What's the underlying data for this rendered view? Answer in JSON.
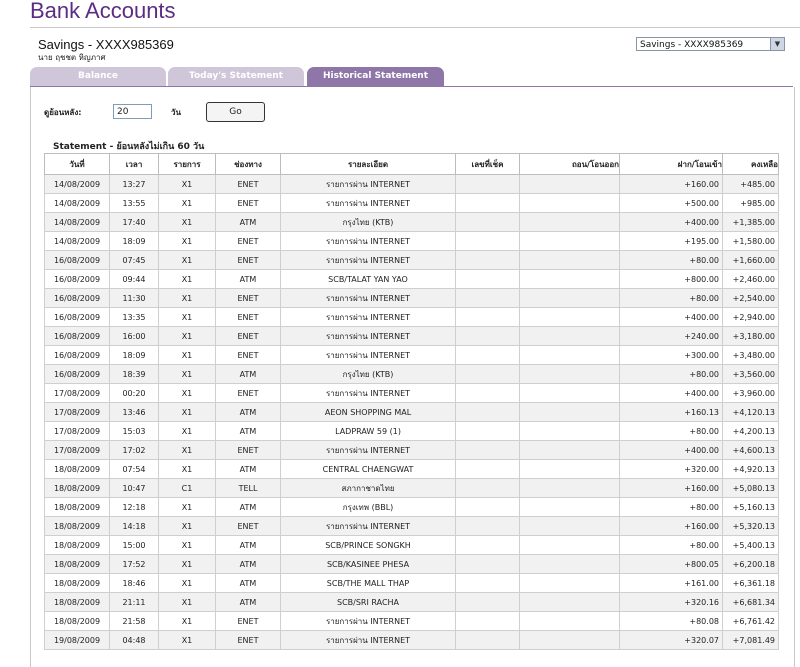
{
  "header": {
    "title": "Bank Accounts"
  },
  "account": {
    "name": "Savings - XXXX985369",
    "owner": "นาย ฤชชต หิญภาศ",
    "selector_value": "Savings - XXXX985369"
  },
  "tabs": [
    {
      "label": "Balance",
      "active": false
    },
    {
      "label": "Today's Statement",
      "active": false
    },
    {
      "label": "Historical Statement",
      "active": true
    }
  ],
  "filter": {
    "label": "ดูย้อนหลัง:",
    "days_value": "20",
    "unit": "วัน",
    "go_label": "Go"
  },
  "statement": {
    "title": "Statement - ย้อนหลังไม่เกิน 60 วัน",
    "columns": [
      "วันที่",
      "เวลา",
      "รายการ",
      "ช่องทาง",
      "รายละเอียด",
      "เลขที่เช็ค",
      "ถอน/โอนออก",
      "ฝาก/โอนเข้า",
      "คงเหลือ"
    ],
    "rows": [
      [
        "14/08/2009",
        "13:27",
        "X1",
        "ENET",
        "รายการผ่าน INTERNET",
        "",
        "",
        "+160.00",
        "+485.00"
      ],
      [
        "14/08/2009",
        "13:55",
        "X1",
        "ENET",
        "รายการผ่าน INTERNET",
        "",
        "",
        "+500.00",
        "+985.00"
      ],
      [
        "14/08/2009",
        "17:40",
        "X1",
        "ATM",
        "กรุงไทย (KTB)",
        "",
        "",
        "+400.00",
        "+1,385.00"
      ],
      [
        "14/08/2009",
        "18:09",
        "X1",
        "ENET",
        "รายการผ่าน INTERNET",
        "",
        "",
        "+195.00",
        "+1,580.00"
      ],
      [
        "16/08/2009",
        "07:45",
        "X1",
        "ENET",
        "รายการผ่าน INTERNET",
        "",
        "",
        "+80.00",
        "+1,660.00"
      ],
      [
        "16/08/2009",
        "09:44",
        "X1",
        "ATM",
        "SCB/TALAT YAN YAO",
        "",
        "",
        "+800.00",
        "+2,460.00"
      ],
      [
        "16/08/2009",
        "11:30",
        "X1",
        "ENET",
        "รายการผ่าน INTERNET",
        "",
        "",
        "+80.00",
        "+2,540.00"
      ],
      [
        "16/08/2009",
        "13:35",
        "X1",
        "ENET",
        "รายการผ่าน INTERNET",
        "",
        "",
        "+400.00",
        "+2,940.00"
      ],
      [
        "16/08/2009",
        "16:00",
        "X1",
        "ENET",
        "รายการผ่าน INTERNET",
        "",
        "",
        "+240.00",
        "+3,180.00"
      ],
      [
        "16/08/2009",
        "18:09",
        "X1",
        "ENET",
        "รายการผ่าน INTERNET",
        "",
        "",
        "+300.00",
        "+3,480.00"
      ],
      [
        "16/08/2009",
        "18:39",
        "X1",
        "ATM",
        "กรุงไทย (KTB)",
        "",
        "",
        "+80.00",
        "+3,560.00"
      ],
      [
        "17/08/2009",
        "00:20",
        "X1",
        "ENET",
        "รายการผ่าน INTERNET",
        "",
        "",
        "+400.00",
        "+3,960.00"
      ],
      [
        "17/08/2009",
        "13:46",
        "X1",
        "ATM",
        "AEON SHOPPING MAL",
        "",
        "",
        "+160.13",
        "+4,120.13"
      ],
      [
        "17/08/2009",
        "15:03",
        "X1",
        "ATM",
        "LADPRAW 59 (1)",
        "",
        "",
        "+80.00",
        "+4,200.13"
      ],
      [
        "17/08/2009",
        "17:02",
        "X1",
        "ENET",
        "รายการผ่าน INTERNET",
        "",
        "",
        "+400.00",
        "+4,600.13"
      ],
      [
        "18/08/2009",
        "07:54",
        "X1",
        "ATM",
        "CENTRAL CHAENGWAT",
        "",
        "",
        "+320.00",
        "+4,920.13"
      ],
      [
        "18/08/2009",
        "10:47",
        "C1",
        "TELL",
        "สภากาชาดไทย",
        "",
        "",
        "+160.00",
        "+5,080.13"
      ],
      [
        "18/08/2009",
        "12:18",
        "X1",
        "ATM",
        "กรุงเทพ (BBL)",
        "",
        "",
        "+80.00",
        "+5,160.13"
      ],
      [
        "18/08/2009",
        "14:18",
        "X1",
        "ENET",
        "รายการผ่าน INTERNET",
        "",
        "",
        "+160.00",
        "+5,320.13"
      ],
      [
        "18/08/2009",
        "15:00",
        "X1",
        "ATM",
        "SCB/PRINCE SONGKH",
        "",
        "",
        "+80.00",
        "+5,400.13"
      ],
      [
        "18/08/2009",
        "17:52",
        "X1",
        "ATM",
        "SCB/KASINEE PHESA",
        "",
        "",
        "+800.05",
        "+6,200.18"
      ],
      [
        "18/08/2009",
        "18:46",
        "X1",
        "ATM",
        "SCB/THE MALL THAP",
        "",
        "",
        "+161.00",
        "+6,361.18"
      ],
      [
        "18/08/2009",
        "21:11",
        "X1",
        "ATM",
        "SCB/SRI RACHA",
        "",
        "",
        "+320.16",
        "+6,681.34"
      ],
      [
        "18/08/2009",
        "21:58",
        "X1",
        "ENET",
        "รายการผ่าน INTERNET",
        "",
        "",
        "+80.08",
        "+6,761.42"
      ],
      [
        "19/08/2009",
        "04:48",
        "X1",
        "ENET",
        "รายการผ่าน INTERNET",
        "",
        "",
        "+320.07",
        "+7,081.49"
      ]
    ]
  }
}
